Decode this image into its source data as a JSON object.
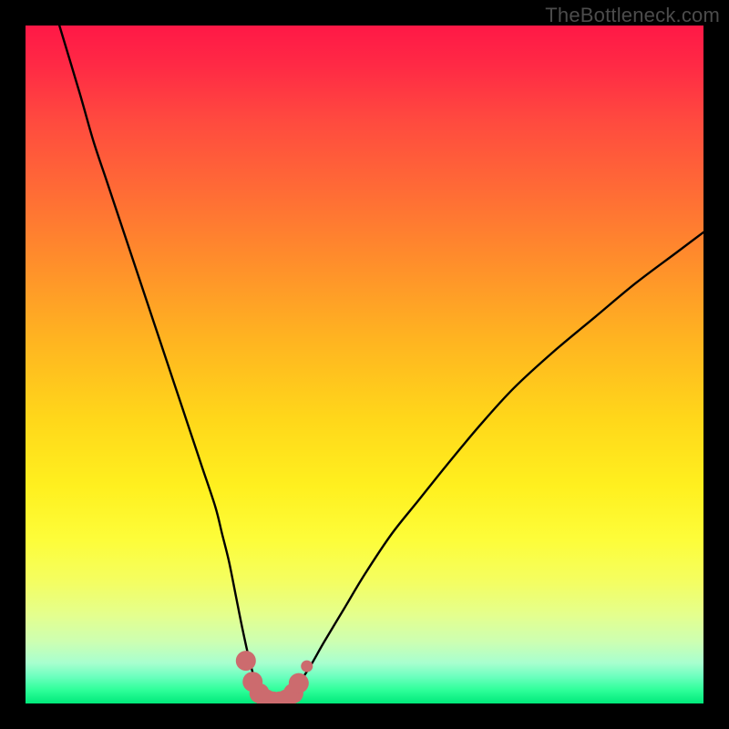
{
  "watermark": "TheBottleneck.com",
  "colors": {
    "frame": "#000000",
    "curve_stroke": "#000000",
    "marker_fill": "#cc6b6e",
    "gradient_top": "#ff1846",
    "gradient_bottom": "#00e97a"
  },
  "chart_data": {
    "type": "line",
    "title": "",
    "xlabel": "",
    "ylabel": "",
    "xlim": [
      0,
      100
    ],
    "ylim": [
      0,
      100
    ],
    "grid": false,
    "legend": false,
    "annotations": [
      "TheBottleneck.com"
    ],
    "series": [
      {
        "name": "bottleneck-curve",
        "x": [
          5,
          8,
          10,
          12,
          14,
          16,
          18,
          20,
          22,
          24,
          26,
          28,
          29,
          30,
          31,
          32,
          33,
          34,
          35,
          36,
          37,
          38,
          39,
          40,
          42,
          44,
          47,
          50,
          54,
          58,
          62,
          67,
          72,
          78,
          84,
          90,
          96,
          100
        ],
        "y": [
          100,
          90,
          83,
          77,
          71,
          65,
          59,
          53,
          47,
          41,
          35,
          29,
          25,
          21,
          16,
          11,
          6.5,
          3,
          1.2,
          0.5,
          0.5,
          0.7,
          1.2,
          2.5,
          5.5,
          9,
          14,
          19,
          25,
          30,
          35,
          41,
          46.5,
          52,
          57,
          62,
          66.5,
          69.5
        ]
      },
      {
        "name": "highlight-markers",
        "x": [
          32.5,
          33.5,
          34.5,
          35.5,
          36.5,
          37.5,
          38.5,
          39.5,
          40.3,
          41.5
        ],
        "y": [
          6.3,
          3.2,
          1.5,
          0.6,
          0.3,
          0.3,
          0.6,
          1.5,
          3.0,
          5.5
        ]
      }
    ]
  }
}
